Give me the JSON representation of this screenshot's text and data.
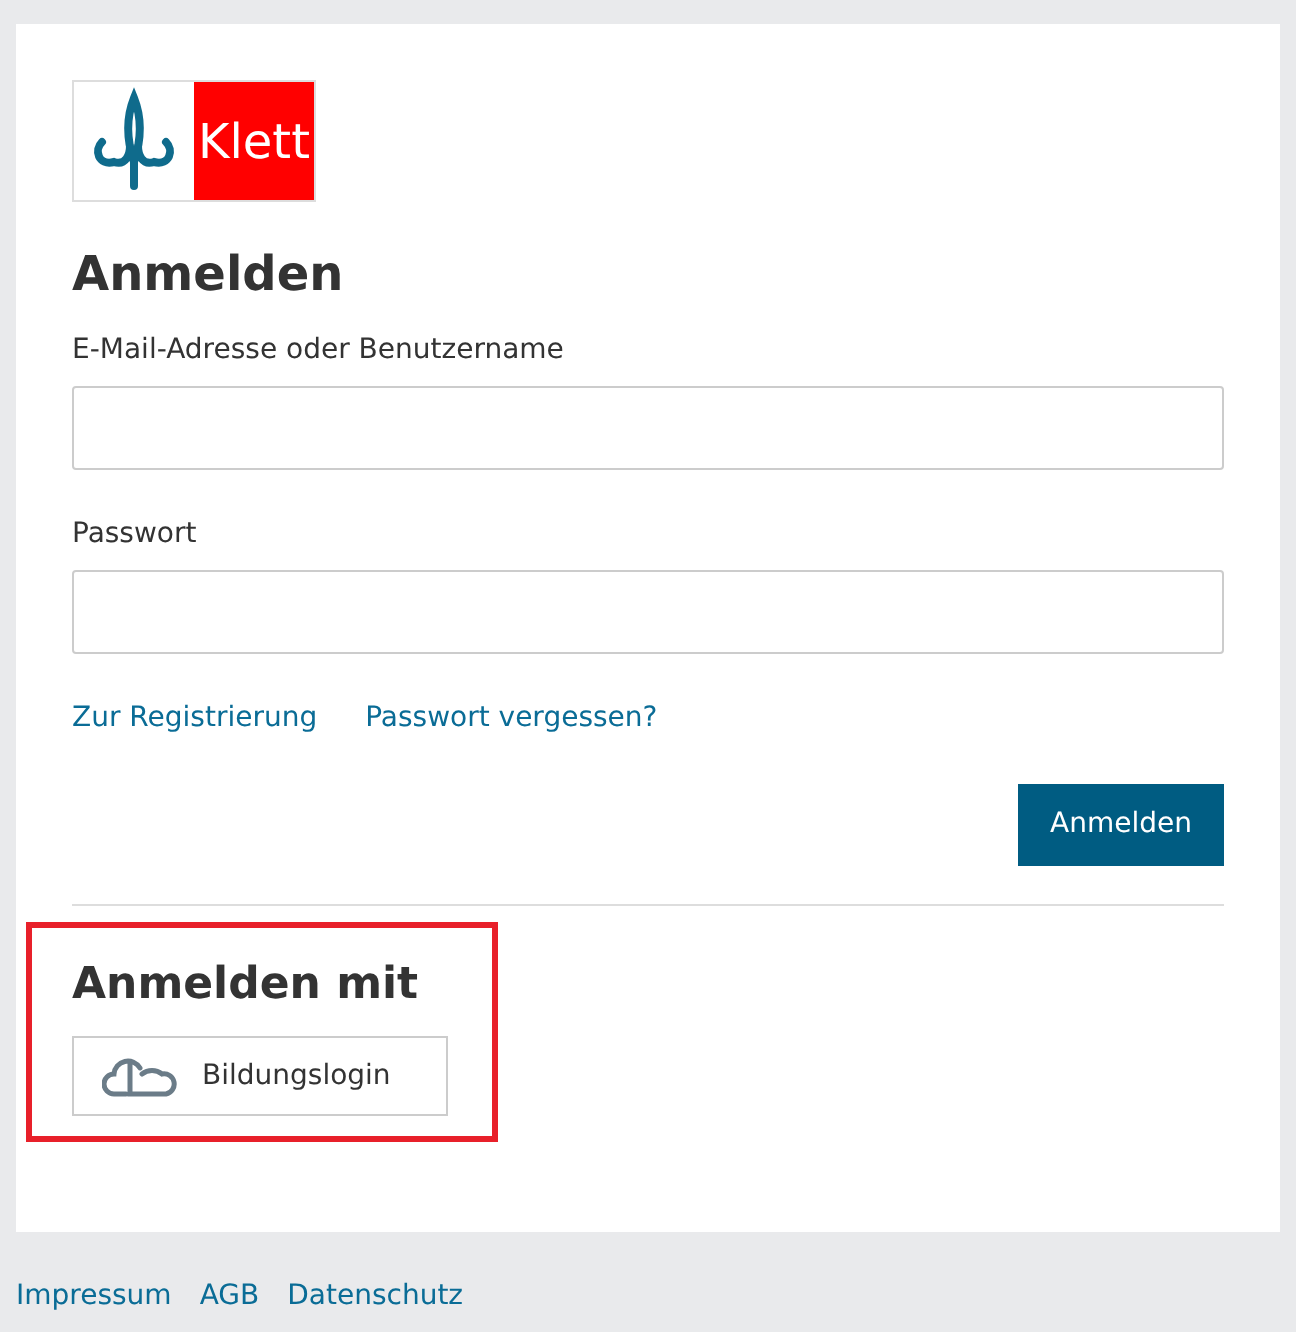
{
  "logo": {
    "text": "Klett"
  },
  "title": "Anmelden",
  "fields": [
    {
      "label": "E-Mail-Adresse oder Benutzername"
    },
    {
      "label": "Passwort"
    }
  ],
  "links": [
    "Zur Registrierung",
    "Passwort vergessen?"
  ],
  "submit": "Anmelden",
  "alt_login": {
    "title": "Anmelden mit",
    "highlighted": true,
    "button": "Bildungslogin"
  },
  "footer": [
    "Impressum",
    "AGB",
    "Datenschutz"
  ]
}
